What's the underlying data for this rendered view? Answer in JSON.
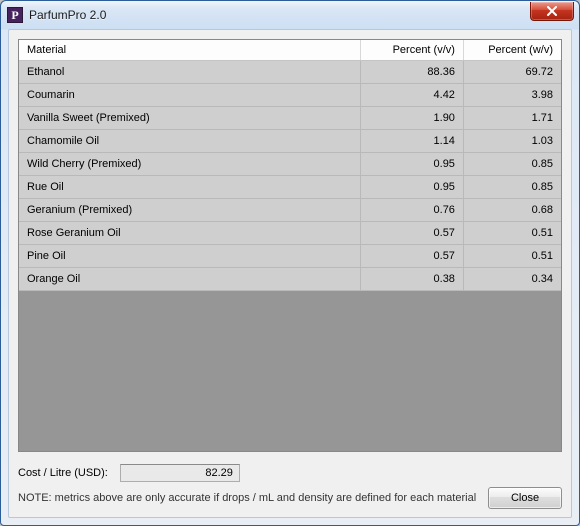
{
  "window": {
    "title": "ParfumPro 2.0",
    "icon_letter": "P"
  },
  "table": {
    "columns": {
      "material": "Material",
      "percent_vv": "Percent (v/v)",
      "percent_wv": "Percent (w/v)"
    },
    "rows": [
      {
        "material": "Ethanol",
        "vv": "88.36",
        "wv": "69.72"
      },
      {
        "material": "Coumarin",
        "vv": "4.42",
        "wv": "3.98"
      },
      {
        "material": "Vanilla Sweet (Premixed)",
        "vv": "1.90",
        "wv": "1.71"
      },
      {
        "material": "Chamomile Oil",
        "vv": "1.14",
        "wv": "1.03"
      },
      {
        "material": "Wild Cherry (Premixed)",
        "vv": "0.95",
        "wv": "0.85"
      },
      {
        "material": "Rue Oil",
        "vv": "0.95",
        "wv": "0.85"
      },
      {
        "material": "Geranium (Premixed)",
        "vv": "0.76",
        "wv": "0.68"
      },
      {
        "material": "Rose Geranium Oil",
        "vv": "0.57",
        "wv": "0.51"
      },
      {
        "material": "Pine Oil",
        "vv": "0.57",
        "wv": "0.51"
      },
      {
        "material": "Orange Oil",
        "vv": "0.38",
        "wv": "0.34"
      }
    ]
  },
  "footer": {
    "cost_label": "Cost / Litre (USD):",
    "cost_value": "82.29",
    "note": "NOTE: metrics above are only accurate if drops / mL and density are defined for each material",
    "close_label": "Close"
  }
}
